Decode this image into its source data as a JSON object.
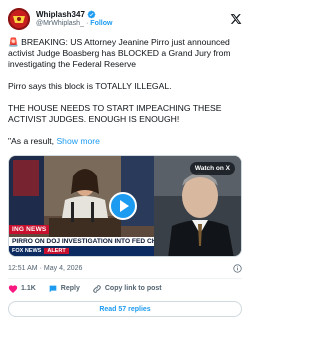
{
  "author": {
    "name": "Whiplash347",
    "handle": "@MrWhiplash_",
    "separator": "·",
    "follow_label": "Follow"
  },
  "tweet": {
    "paragraph_1": "🚨 BREAKING: US Attorney Jeanine Pirro just announced activist Judge Boasberg has BLOCKED a Grand Jury from investigating the Federal Reserve",
    "paragraph_2": "Pirro says this block is TOTALLY ILLEGAL.",
    "paragraph_3": "THE HOUSE NEEDS TO START IMPEACHING THESE ACTIVIST JUDGES. ENOUGH IS ENOUGH!",
    "paragraph_4": "\"As a result,",
    "show_more": "Show more"
  },
  "media": {
    "watch_label": "Watch on X",
    "breaking_banner": "ING NEWS",
    "headline": "PIRRO ON DOJ INVESTIGATION INTO FED CH",
    "network_tag": "FOX NEWS",
    "alert_tag": "ALERT"
  },
  "meta": {
    "time": "12:51 AM",
    "date": "May 4, 2026",
    "separator": "·"
  },
  "actions": {
    "likes": "1.1K",
    "reply": "Reply",
    "copy": "Copy link to post"
  },
  "replies_label": "Read 57 replies",
  "colors": {
    "accent": "#1d9bf0",
    "like": "#f91880",
    "fox_red": "#c8102e",
    "fox_navy": "#0c2b60"
  }
}
